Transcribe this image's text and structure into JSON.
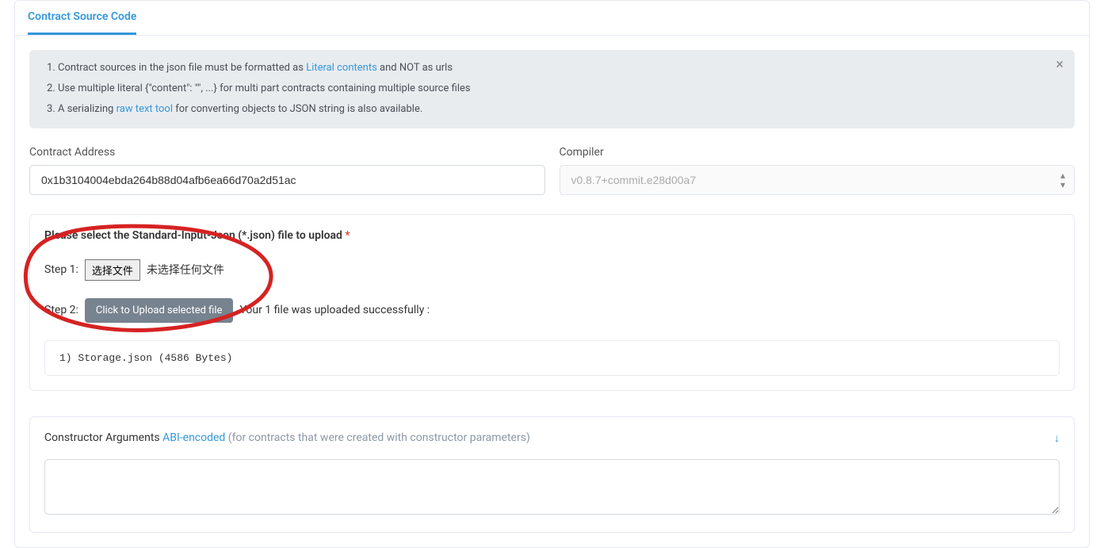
{
  "tab": {
    "title": "Contract Source Code"
  },
  "infoBox": {
    "item1_part1": "Contract sources in the json file must be formatted as ",
    "item1_link": "Literal contents",
    "item1_part2": " and NOT as urls",
    "item2": "Use multiple literal {\"content\": \"\", ...} for multi part contracts containing multiple source files",
    "item3_part1": "A serializing ",
    "item3_link": "raw text tool",
    "item3_part2": " for converting objects to JSON string is also available.",
    "close": "×"
  },
  "contractAddress": {
    "label": "Contract Address",
    "value": "0x1b3104004ebda264b88d04afb6ea66d70a2d51ac"
  },
  "compiler": {
    "label": "Compiler",
    "value": "v0.8.7+commit.e28d00a7"
  },
  "upload": {
    "title": "Please select the Standard-Input-Json (*.json) file to upload",
    "required": "*",
    "step1_label": "Step 1:",
    "chooseFile": "选择文件",
    "noFile": "未选择任何文件",
    "step2_label": "Step 2:",
    "uploadBtn": "Click to Upload selected file",
    "status": "Your 1 file was uploaded successfully :",
    "fileList": "1)  Storage.json   (4586 Bytes)"
  },
  "constructor": {
    "label": "Constructor Arguments ",
    "link": "ABI-encoded",
    "hint": " (for contracts that were created with constructor parameters)"
  }
}
